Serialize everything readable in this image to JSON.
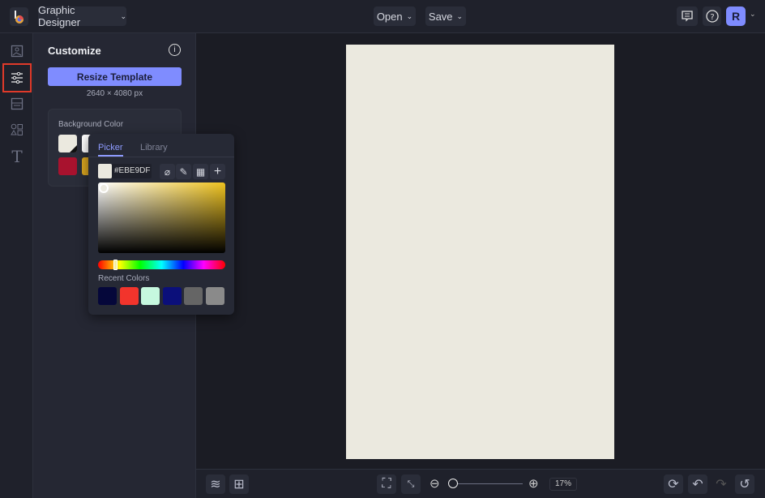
{
  "topbar": {
    "app_menu": "Graphic Designer",
    "open": "Open",
    "save": "Save",
    "avatar": "R"
  },
  "panel": {
    "title": "Customize",
    "resize_button": "Resize Template",
    "dimensions": "2640 × 4080 px",
    "bg_color_label": "Background Color",
    "swatches": [
      "#ebe9df",
      "#ffffff",
      "#a8122e",
      "#d9a520"
    ]
  },
  "picker": {
    "tabs": [
      "Picker",
      "Library"
    ],
    "active_tab": "Picker",
    "hex": "#EBE9DF",
    "recent_label": "Recent Colors",
    "recent_colors": [
      "#05073a",
      "#f2342c",
      "#c6f8df",
      "#0b0f7a",
      "#656565",
      "#8a8a8a"
    ],
    "hue_fraction": 0.13
  },
  "canvas": {
    "page_color": "#ebe9df"
  },
  "bottom": {
    "zoom": "17%",
    "zoom_fraction": 0.05
  },
  "colors": {
    "accent": "#7f8cff",
    "highlight": "#e03a2a"
  }
}
